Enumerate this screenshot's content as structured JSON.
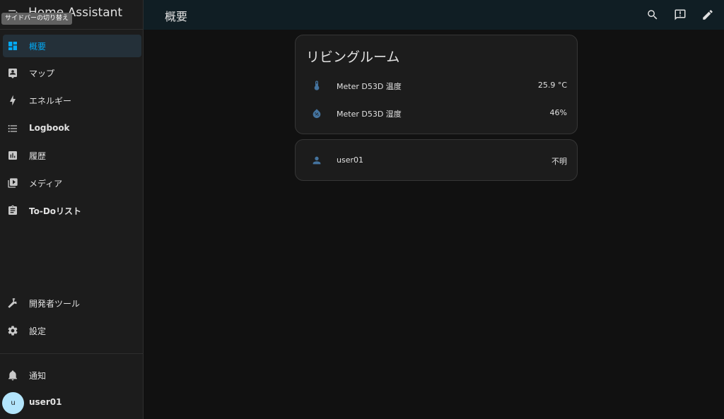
{
  "sidebar": {
    "title": "Home Assistant",
    "tooltip": "サイドバーの切り替え",
    "items": [
      {
        "label": "概要",
        "icon": "dashboard-icon",
        "active": true
      },
      {
        "label": "マップ",
        "icon": "map-account-icon"
      },
      {
        "label": "エネルギー",
        "icon": "lightning-bolt-icon"
      },
      {
        "label": "Logbook",
        "icon": "format-list-bulleted-icon"
      },
      {
        "label": "履歴",
        "icon": "chart-box-icon"
      },
      {
        "label": "メディア",
        "icon": "play-box-multiple-icon"
      },
      {
        "label": "To-Doリスト",
        "icon": "clipboard-list-icon"
      }
    ],
    "bottom_items": [
      {
        "label": "開発者ツール",
        "icon": "hammer-icon"
      },
      {
        "label": "設定",
        "icon": "cog-icon"
      }
    ],
    "notifications_label": "通知",
    "user": {
      "initial": "u",
      "name": "user01"
    }
  },
  "topbar": {
    "title": "概要",
    "icons": [
      "search-icon",
      "assist-chat-icon",
      "pencil-icon"
    ]
  },
  "cards": {
    "room": {
      "title": "リビングルーム",
      "rows": [
        {
          "name": "Meter D53D 温度",
          "value": "25.9 °C",
          "icon": "thermometer-icon"
        },
        {
          "name": "Meter D53D 湿度",
          "value": "46%",
          "icon": "water-percent-icon"
        }
      ]
    },
    "person": {
      "rows": [
        {
          "name": "user01",
          "value": "不明",
          "icon": "account-icon"
        }
      ]
    }
  },
  "colors": {
    "accent": "#03a9f4",
    "icon_state": "#44739e",
    "sidebar_bg": "#1c1c1c",
    "topbar_bg": "#101e24",
    "page_bg": "#111111",
    "card_bg": "#1c1c1c"
  }
}
